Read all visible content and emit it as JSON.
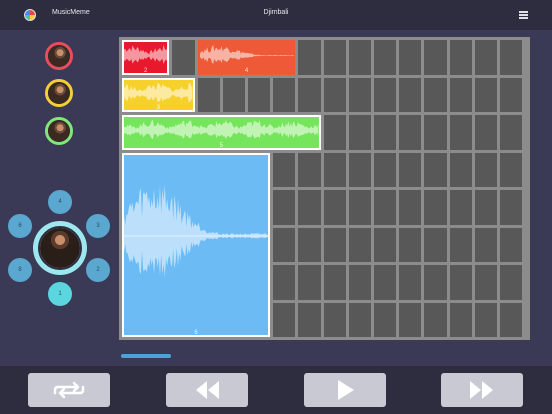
{
  "header": {
    "app_name": "MusicMeme",
    "song_title": "Djimbali",
    "logo_icon": "musicmeme-logo-icon",
    "menu_icon": "hamburger-menu-icon"
  },
  "tracks": [
    {
      "name": "track-red",
      "ring_color": "#e84d5b"
    },
    {
      "name": "track-yellow",
      "ring_color": "#f4cf3a"
    },
    {
      "name": "track-green",
      "ring_color": "#82e67b"
    }
  ],
  "clips": [
    {
      "label": "2",
      "color": "#e8192c",
      "row": 0,
      "col": 0,
      "span": 2,
      "rows": 1,
      "selected": true
    },
    {
      "label": "4",
      "color": "#ee5a38",
      "row": 0,
      "col": 3,
      "span": 4,
      "rows": 1,
      "selected": false
    },
    {
      "label": "3",
      "color": "#f6d12c",
      "row": 1,
      "col": 0,
      "span": 3,
      "rows": 1,
      "selected": true
    },
    {
      "label": "5",
      "color": "#75e55c",
      "row": 2,
      "col": 0,
      "span": 8,
      "rows": 1,
      "selected": true
    },
    {
      "label": "6",
      "color": "#6cbbf5",
      "row": 3,
      "col": 0,
      "span": 6,
      "rows": 5,
      "selected": true
    }
  ],
  "pads": [
    {
      "label": "4",
      "color": "#5aa7cf"
    },
    {
      "label": "3",
      "color": "#5aa7cf"
    },
    {
      "label": "2",
      "color": "#5aa7cf"
    },
    {
      "label": "1",
      "color": "#5bd6de"
    },
    {
      "label": "8",
      "color": "#5aa7cf"
    },
    {
      "label": "6",
      "color": "#5aa7cf"
    }
  ],
  "transport": [
    {
      "name": "loop-button",
      "icon": "loop-icon"
    },
    {
      "name": "rewind-button",
      "icon": "rewind-icon"
    },
    {
      "name": "play-button",
      "icon": "play-icon"
    },
    {
      "name": "fast-forward-button",
      "icon": "fast-forward-icon"
    }
  ]
}
